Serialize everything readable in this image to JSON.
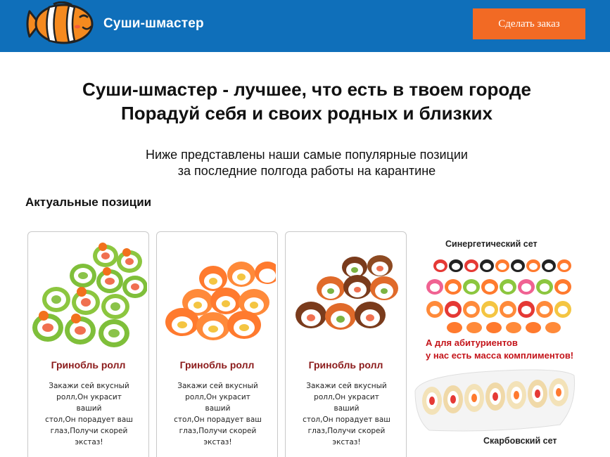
{
  "header": {
    "brand": "Суши-шмастер",
    "order_button": "Сделать заказ",
    "logo_icon": "clownfish-logo-icon"
  },
  "hero": {
    "title_line1": "Суши-шмастер - лучшее, что есть в твоем городе",
    "title_line2": "Порадуй себя и своих родных и близких",
    "sub_line1": "Ниже представлены наши самые популярные позиции",
    "sub_line2": "за последние полгода работы на карантине"
  },
  "section": {
    "title": "Актуальные позиции"
  },
  "cards": [
    {
      "name": "Гринобль ролл",
      "desc": [
        "Закажи сей вкусный",
        "ролл,Он украсит ваший",
        "стол,Он порадует ваш",
        "глаз,Получи скорей",
        "экстаз!"
      ],
      "image": "green-avocado-rolls-image"
    },
    {
      "name": "Гринобль ролл",
      "desc": [
        "Закажи сей вкусный",
        "ролл,Он украсит ваший",
        "стол,Он порадует ваш",
        "глаз,Получи скорей",
        "экстаз!"
      ],
      "image": "salmon-rolls-image"
    },
    {
      "name": "Гринобль ролл",
      "desc": [
        "Закажи сей вкусный",
        "ролл,Он украсит ваший",
        "стол,Он порадует ваш",
        "глаз,Получи скорей",
        "экстаз!"
      ],
      "image": "eel-rolls-image"
    }
  ],
  "promo": {
    "set1": "Синергетический сет",
    "line1": "А для абитуриентов",
    "line2": "у нас есть масса комплиментов!",
    "set2": "Скарбовский сет"
  },
  "colors": {
    "header_bg": "#0f6fba",
    "button_bg": "#f26a24",
    "card_title": "#8b1a1a",
    "promo_red": "#c4141a"
  }
}
